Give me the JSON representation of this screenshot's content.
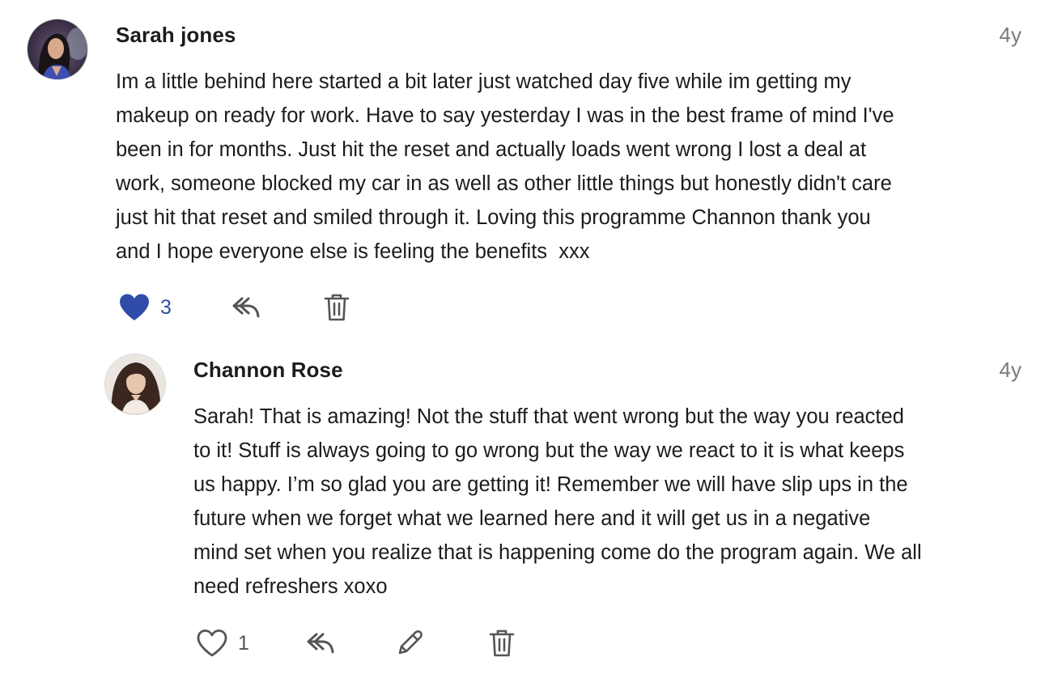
{
  "comments": [
    {
      "author": "Sarah jones",
      "time": "4y",
      "lines": [
        "Im a little behind here started a bit later just watched day five while im getting my",
        "makeup on ready for work. Have to say yesterday I was in the best frame of mind I've",
        "been in for months. Just hit the reset and actually loads went wrong I lost a deal at",
        "work, someone blocked my car in as well as other little things but honestly didn't care",
        "just hit that reset and smiled through it. Loving this programme Channon thank you",
        "and I hope everyone else is feeling the benefits  xxx"
      ],
      "likes": "3",
      "liked": true,
      "actions": [
        "heart-filled-icon",
        "reply-icon",
        "trash-icon"
      ]
    },
    {
      "author": "Channon Rose",
      "time": "4y",
      "lines": [
        "Sarah! That is amazing! Not the stuff that went wrong but the way you reacted",
        "to it! Stuff is always going to go wrong but the way we react to it is what keeps",
        "us happy. I’m so glad you are getting it! Remember we will have slip ups in the",
        "future when we forget what we learned here and it will get us in a negative",
        "mind set when you realize that is happening come do the program again. We all",
        "need refreshers xoxo"
      ],
      "likes": "1",
      "liked": false,
      "actions": [
        "heart-outline-icon",
        "reply-icon",
        "pencil-icon",
        "trash-icon"
      ]
    }
  ],
  "colors": {
    "like_blue": "#2f4da8",
    "text": "#1c1c1c",
    "muted": "#7a7a7a",
    "icon": "#555555"
  }
}
